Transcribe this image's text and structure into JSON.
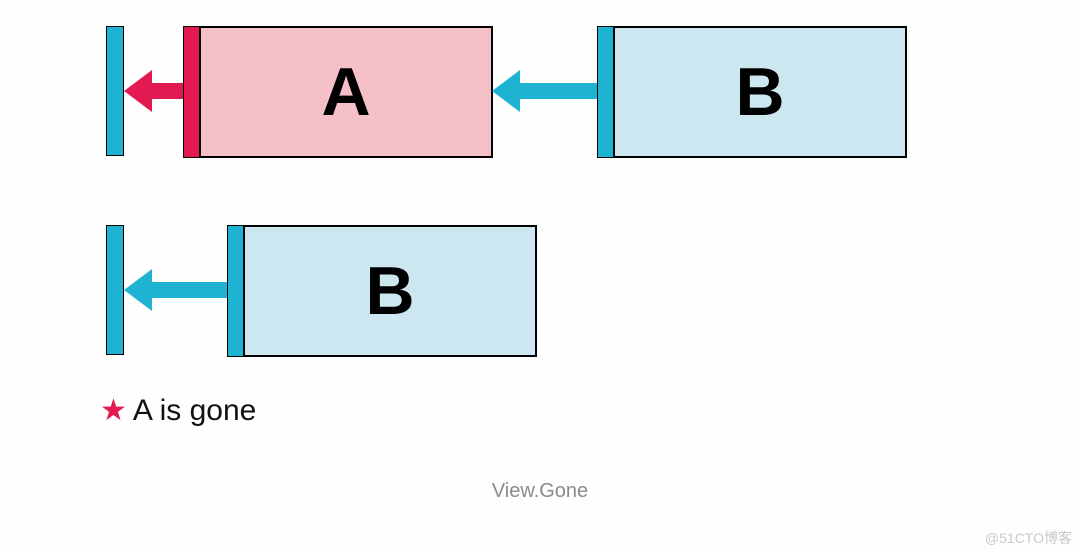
{
  "row1": {
    "boxA_label": "A",
    "boxB_label": "B"
  },
  "row2": {
    "boxB_label": "B"
  },
  "note_text": "A is gone",
  "caption_text": "View.Gone",
  "watermark_text": "@51CTO博客",
  "colors": {
    "blue": "#1fb3d3",
    "red": "#e31a52",
    "pink_fill": "#f6c0c9",
    "lightblue_fill": "#cde7f0"
  },
  "diagram_meaning": {
    "description": "Two states showing android View visibility GONE behavior",
    "state1": "Box A (pink) anchored to left wall via red arrow, Box B (light blue) anchored to right edge of A via blue arrow",
    "state2": "A is gone (visibility GONE); B now anchors directly to the left wall"
  }
}
